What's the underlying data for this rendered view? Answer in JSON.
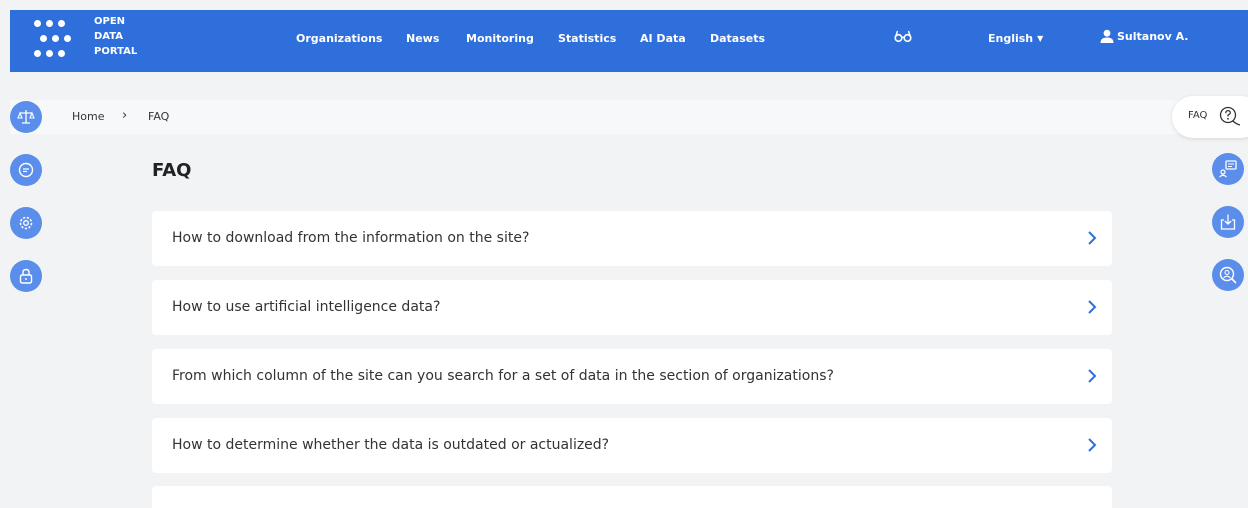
{
  "brand": {
    "line1": "OPEN",
    "line2": "DATA",
    "line3": "PORTAL"
  },
  "nav": {
    "items": [
      {
        "label": "Organizations"
      },
      {
        "label": "News"
      },
      {
        "label": "Monitoring"
      },
      {
        "label": "Statistics"
      },
      {
        "label": "AI Data"
      },
      {
        "label": "Datasets"
      }
    ],
    "accessibility_icon": "glasses-icon",
    "language": "English",
    "user": "Sultanov A."
  },
  "breadcrumb": {
    "home": "Home",
    "separator": "›",
    "current": "FAQ"
  },
  "sidebar": {
    "icons": [
      "scales-icon",
      "chat-icon",
      "settings-icon",
      "lock-icon"
    ]
  },
  "right_panel": {
    "faq_label": "FAQ",
    "icons": [
      "faq-question-icon",
      "feedback-icon",
      "download-icon",
      "search-person-icon"
    ]
  },
  "main": {
    "title": "FAQ",
    "questions": [
      {
        "text": "How to download from the information on the site?"
      },
      {
        "text": "How to use artificial intelligence data?"
      },
      {
        "text": "From which column of the site can you search for a set of data in the section of organizations?"
      },
      {
        "text": "How to determine whether the data is outdated or actualized?"
      }
    ]
  },
  "colors": {
    "header": "#2f6fdc",
    "accent_button": "#5a8eea",
    "chevron": "#2f6fdc",
    "background": "#f2f3f5"
  }
}
